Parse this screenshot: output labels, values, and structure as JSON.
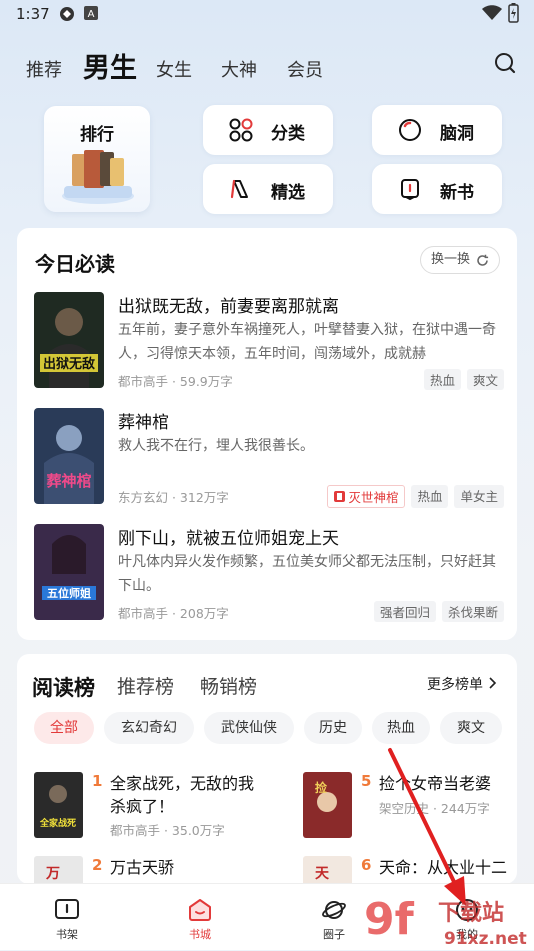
{
  "status": {
    "time": "1:37"
  },
  "header": {
    "tabs": [
      {
        "label": "推荐"
      },
      {
        "label": "男生"
      },
      {
        "label": "女生"
      },
      {
        "label": "大神"
      },
      {
        "label": "会员"
      }
    ]
  },
  "quick": {
    "rank": "排行",
    "category": "分类",
    "brain": "脑洞",
    "select": "精选",
    "newbook": "新书"
  },
  "today": {
    "title": "今日必读",
    "refresh": "换一换",
    "books": [
      {
        "title": "出狱既无敌，前妻要离那就离",
        "desc": "五年前，妻子意外车祸撞死人，叶擘替妻入狱，在狱中遇一奇人，习得惊天本领，五年时间，闯荡域外，成就赫",
        "meta": "都市高手 · 59.9万字",
        "tags": [
          "热血",
          "爽文"
        ]
      },
      {
        "title": "葬神棺",
        "desc": "救人我不在行，埋人我很善长。",
        "meta": "东方玄幻 · 312万字",
        "special_tag": "灭世神棺",
        "tags": [
          "热血",
          "单女主"
        ]
      },
      {
        "title": "刚下山，就被五位师姐宠上天",
        "desc": "叶凡体内异火发作频繁，五位美女师父都无法压制，只好赶其下山。",
        "meta": "都市高手 · 208万字",
        "tags": [
          "强者回归",
          "杀伐果断"
        ]
      }
    ]
  },
  "rankings": {
    "tabs": [
      "阅读榜",
      "推荐榜",
      "畅销榜"
    ],
    "more": "更多榜单",
    "chips": [
      "全部",
      "玄幻奇幻",
      "武侠仙侠",
      "历史",
      "热血",
      "爽文"
    ],
    "items": [
      {
        "num": "1",
        "title": "全家战死，无敌的我杀疯了！",
        "meta": "都市高手 · 35.0万字"
      },
      {
        "num": "5",
        "title": "捡个女帝当老婆",
        "meta": "架空历史 · 244万字"
      },
      {
        "num": "2",
        "title": "万古天骄",
        "meta": ""
      },
      {
        "num": "6",
        "title": "天命：从大业十二",
        "meta": ""
      }
    ]
  },
  "nav": {
    "items": [
      {
        "label": "书架"
      },
      {
        "label": "书城"
      },
      {
        "label": "圈子"
      },
      {
        "label": "我的"
      }
    ]
  },
  "colors": {
    "accent": "#e23a3a",
    "rank_number": "#f07a3a"
  }
}
